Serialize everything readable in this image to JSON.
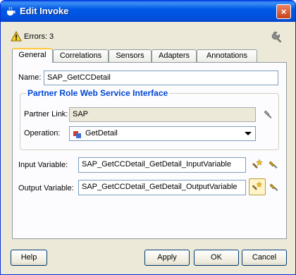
{
  "window": {
    "title": "Edit Invoke",
    "close_label": "×"
  },
  "errors": {
    "text": "Errors: 3"
  },
  "tabs": [
    {
      "label": "General",
      "active": true
    },
    {
      "label": "Correlations"
    },
    {
      "label": "Sensors"
    },
    {
      "label": "Adapters"
    },
    {
      "label": "Annotations"
    }
  ],
  "form": {
    "name_label": "Name:",
    "name_value": "SAP_GetCCDetail",
    "group_title": "Partner Role Web Service Interface",
    "partner_link_label": "Partner Link:",
    "partner_link_value": "SAP",
    "operation_label": "Operation:",
    "operation_value": "GetDetail",
    "input_variable_label": "Input Variable:",
    "input_variable_value": "SAP_GetCCDetail_GetDetail_InputVariable",
    "output_variable_label": "Output Variable:",
    "output_variable_value": "SAP_GetCCDetail_GetDetail_OutputVariable"
  },
  "buttons": {
    "help": "Help",
    "apply": "Apply",
    "ok": "OK",
    "cancel": "Cancel"
  },
  "icons": {
    "title": "coffee-cup-icon",
    "warning": "warning-icon",
    "wrench": "wrench-icon",
    "browse": "flashlight-icon",
    "create": "create-variable-icon",
    "operation": "operation-icon"
  }
}
